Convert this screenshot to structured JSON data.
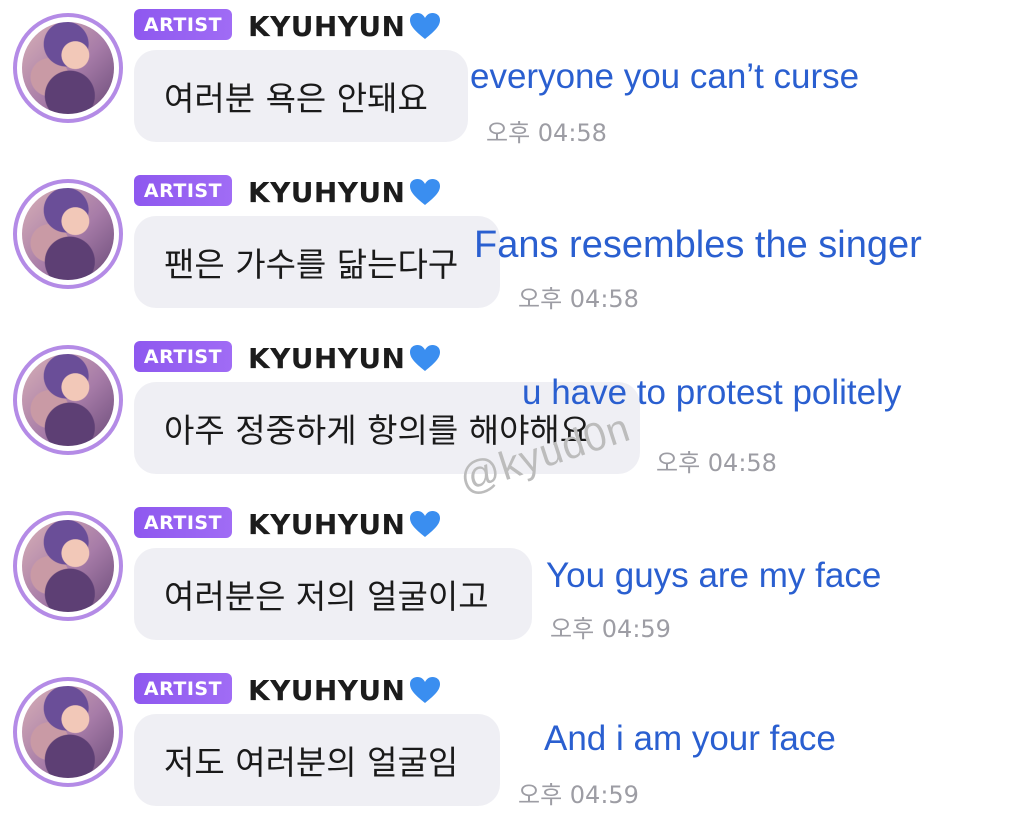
{
  "messages": [
    {
      "badge": "ARTIST",
      "sender": "KYUHYUN",
      "heart_icon": "blue-heart-icon",
      "text": "여러분 욕은 안돼요",
      "time": "오후 04:58",
      "translation": "everyone you can’t curse"
    },
    {
      "badge": "ARTIST",
      "sender": "KYUHYUN",
      "heart_icon": "blue-heart-icon",
      "text": "팬은 가수를 닮는다구",
      "time": "오후 04:58",
      "translation": "Fans resembles the singer"
    },
    {
      "badge": "ARTIST",
      "sender": "KYUHYUN",
      "heart_icon": "blue-heart-icon",
      "text": "아주 정중하게 항의를 해야해요",
      "time": "오후 04:58",
      "translation": "u have to protest politely"
    },
    {
      "badge": "ARTIST",
      "sender": "KYUHYUN",
      "heart_icon": "blue-heart-icon",
      "text": "여러분은 저의 얼굴이고",
      "time": "오후 04:59",
      "translation": "You guys are my face"
    },
    {
      "badge": "ARTIST",
      "sender": "KYUHYUN",
      "heart_icon": "blue-heart-icon",
      "text": "저도 여러분의 얼굴임",
      "time": "오후 04:59",
      "translation": "And i am your face"
    }
  ],
  "watermark": "@kyud0n",
  "colors": {
    "badge": "#9462f2",
    "translation": "#2a5fd0",
    "bubble": "#efeff4",
    "heart": "#3a8ef0",
    "avatar_ring": "#b48be6"
  }
}
